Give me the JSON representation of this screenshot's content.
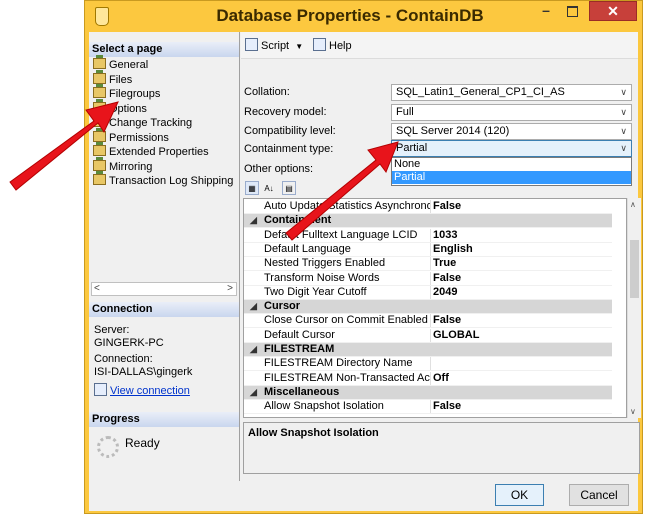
{
  "window": {
    "title": "Database Properties - ContainDB",
    "close_glyph": "✕",
    "minimize_glyph": "–"
  },
  "left": {
    "select_page_header": "Select a page",
    "pages": [
      "General",
      "Files",
      "Filegroups",
      "Options",
      "Change Tracking",
      "Permissions",
      "Extended Properties",
      "Mirroring",
      "Transaction Log Shipping"
    ],
    "connection_header": "Connection",
    "server_label": "Server:",
    "server_value": "GINGERK-PC",
    "connection_label": "Connection:",
    "connection_value": "ISI-DALLAS\\gingerk",
    "view_connection": "View connection",
    "progress_header": "Progress",
    "progress_status": "Ready"
  },
  "toolbar": {
    "script_label": "Script",
    "help_label": "Help"
  },
  "form": {
    "collation_label": "Collation:",
    "collation_value": "SQL_Latin1_General_CP1_CI_AS",
    "recovery_label": "Recovery model:",
    "recovery_value": "Full",
    "compat_label": "Compatibility level:",
    "compat_value": "SQL Server 2014 (120)",
    "containment_label": "Containment type:",
    "containment_value": "Partial",
    "containment_options": [
      "None",
      "Partial"
    ],
    "other_options_label": "Other options:"
  },
  "properties": [
    {
      "kind": "prop",
      "name": "Auto Update Statistics Asynchronously",
      "value": "False"
    },
    {
      "kind": "cat",
      "name": "Containment"
    },
    {
      "kind": "prop",
      "name": "Default Fulltext Language LCID",
      "value": "1033"
    },
    {
      "kind": "prop",
      "name": "Default Language",
      "value": "English"
    },
    {
      "kind": "prop",
      "name": "Nested Triggers Enabled",
      "value": "True"
    },
    {
      "kind": "prop",
      "name": "Transform Noise Words",
      "value": "False"
    },
    {
      "kind": "prop",
      "name": "Two Digit Year Cutoff",
      "value": "2049"
    },
    {
      "kind": "cat",
      "name": "Cursor"
    },
    {
      "kind": "prop",
      "name": "Close Cursor on Commit Enabled",
      "value": "False"
    },
    {
      "kind": "prop",
      "name": "Default Cursor",
      "value": "GLOBAL"
    },
    {
      "kind": "cat",
      "name": "FILESTREAM"
    },
    {
      "kind": "prop",
      "name": "FILESTREAM Directory Name",
      "value": ""
    },
    {
      "kind": "prop",
      "name": "FILESTREAM Non-Transacted Access",
      "value": "Off"
    },
    {
      "kind": "cat",
      "name": "Miscellaneous"
    },
    {
      "kind": "prop",
      "name": "Allow Snapshot Isolation",
      "value": "False"
    }
  ],
  "description_title": "Allow Snapshot Isolation",
  "buttons": {
    "ok": "OK",
    "cancel": "Cancel"
  },
  "colors": {
    "title_bar": "#fcc83f",
    "close": "#c7403a",
    "arrow": "#e8141b",
    "selection": "#3399ff"
  }
}
